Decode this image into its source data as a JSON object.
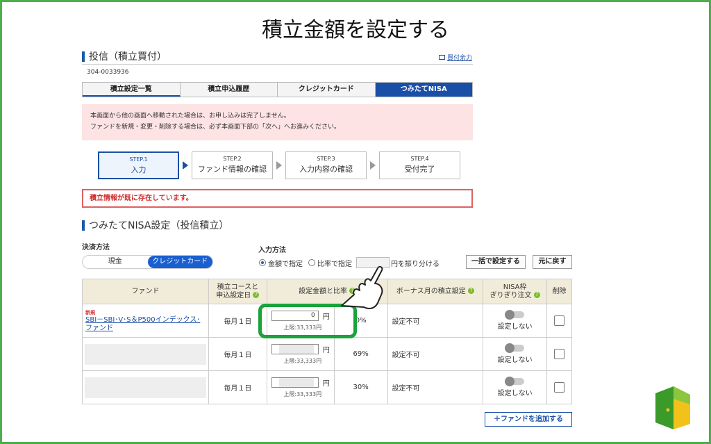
{
  "headline": "積立金額を設定する",
  "section1": {
    "title": "投信（積立買付）",
    "buy_power_link": "買付余力",
    "account_no": "304-0033936"
  },
  "tabs": [
    "積立設定一覧",
    "積立申込履歴",
    "クレジットカード",
    "つみたてNISA"
  ],
  "notice": {
    "line1": "本画面から他の画面へ移動された場合は、お申し込みは完了しません。",
    "line2": "ファンドを新規・変更・削除する場合は、必ず本画面下部の「次へ」へお進みください。"
  },
  "steps": [
    {
      "num": "STEP.1",
      "label": "入力"
    },
    {
      "num": "STEP.2",
      "label": "ファンド情報の確認"
    },
    {
      "num": "STEP.3",
      "label": "入力内容の確認"
    },
    {
      "num": "STEP.4",
      "label": "受付完了"
    }
  ],
  "error_message": "積立情報が既に存在しています。",
  "section2": {
    "title": "つみたてNISA設定（投信積立）"
  },
  "payment": {
    "label": "決済方法",
    "options": [
      "現金",
      "クレジットカード"
    ],
    "selected": "クレジットカード"
  },
  "input_method": {
    "label": "入力方法",
    "option_amount": "金額で指定",
    "option_ratio": "比率で指定",
    "ratio_suffix": "円を振り分ける",
    "selected": "金額で指定"
  },
  "buttons": {
    "bulk_set": "一括で設定する",
    "reset": "元に戻す",
    "add_fund": "＋ファンドを追加する"
  },
  "table": {
    "headers": {
      "fund": "ファンド",
      "course_line1": "積立コースと",
      "course_line2": "申込設定日",
      "amount": "設定金額と比率",
      "bonus": "ボーナス月の積立設定",
      "nisa_line1": "NISA枠",
      "nisa_line2": "ぎりぎり注文",
      "delete": "削除"
    },
    "rows": [
      {
        "new_tag": "新規",
        "fund_line1": "SBI－SBI･V･S＆P500インデックス･",
        "fund_line2": "ファンド",
        "course": "毎月１日",
        "amount": "0",
        "yen": "円",
        "limit": "上限:33,333円",
        "ratio": "0%",
        "bonus": "設定不可",
        "nisa_status": "設定しない"
      },
      {
        "new_tag": "",
        "fund_line1": "",
        "fund_line2": "",
        "course": "毎月１日",
        "amount": "",
        "yen": "円",
        "limit": "上限:33,333円",
        "ratio": "69%",
        "bonus": "設定不可",
        "nisa_status": "設定しない"
      },
      {
        "new_tag": "",
        "fund_line1": "",
        "fund_line2": "",
        "course": "毎月１日",
        "amount": "",
        "yen": "円",
        "limit": "上限:33,333円",
        "ratio": "30%",
        "bonus": "設定不可",
        "nisa_status": "設定しない"
      }
    ]
  },
  "colors": {
    "accent_blue": "#1a4fa8",
    "highlight_green": "#1aa33a",
    "frame_green": "#4cae4c",
    "error_red": "#d03030"
  }
}
